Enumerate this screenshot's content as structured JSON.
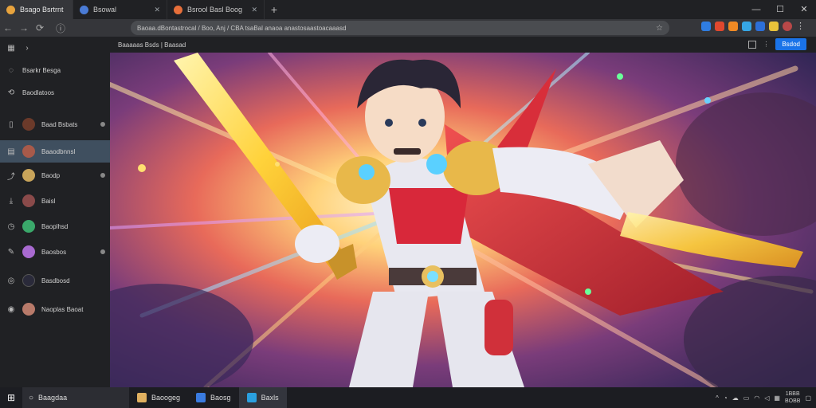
{
  "tabs": [
    {
      "label": "Bsago Bsrtrnt",
      "color": "#e8a33d"
    },
    {
      "label": "Bsowal",
      "color": "#4a7bd6"
    },
    {
      "label": "Bsrool Basl Boog",
      "color": "#e76f3a"
    }
  ],
  "window": {
    "min": "—",
    "max": "☐",
    "close": "✕"
  },
  "urlbar": {
    "url": "Baoaa.dBontastrocal / Boo, Anj / CBA tsaBal anaoa anastosaastoacaaasd"
  },
  "sidebar": {
    "top_items": [
      {
        "icon": "▦",
        "label": ""
      },
      {
        "icon": "◌",
        "label": "Bsarkr Besga"
      },
      {
        "icon": "⟲",
        "label": "Baodlatoos"
      }
    ],
    "contacts": [
      {
        "label": "Baad Bsbats",
        "color": "#6b3a2a",
        "dot": true
      },
      {
        "label": "Baaodbnnsl",
        "color": "#a85a4a",
        "dot": false
      },
      {
        "label": "Baodp",
        "color": "#c8a45a",
        "dot": true
      },
      {
        "label": "Baisl",
        "color": "#8a4a4a",
        "dot": false
      },
      {
        "label": "Baoplhsd",
        "color": "#3aa86a",
        "dot": false
      },
      {
        "label": "Baosbos",
        "color": "#a86ad0",
        "dot": true
      },
      {
        "label": "Basdbosd",
        "color": "#2a2a3a",
        "dot": false
      },
      {
        "label": "Naoplas Baoat",
        "color": "#b87a6a",
        "dot": false
      }
    ]
  },
  "viewer": {
    "path": "Baaaaas  Bsds  |  Baasad",
    "action": "Bsdod"
  },
  "taskbar": {
    "search": "Baagdaa",
    "apps": [
      {
        "label": "Baoogeg",
        "color": "#e0b060"
      },
      {
        "label": "Baosg",
        "color": "#3a7be0"
      },
      {
        "label": "Baxls",
        "color": "#2aa0e0"
      }
    ],
    "clock_time": "1BBB",
    "clock_date": "BOBB"
  },
  "colors": {
    "accent": "#1a73e8",
    "selected": "#3f4f5f"
  }
}
